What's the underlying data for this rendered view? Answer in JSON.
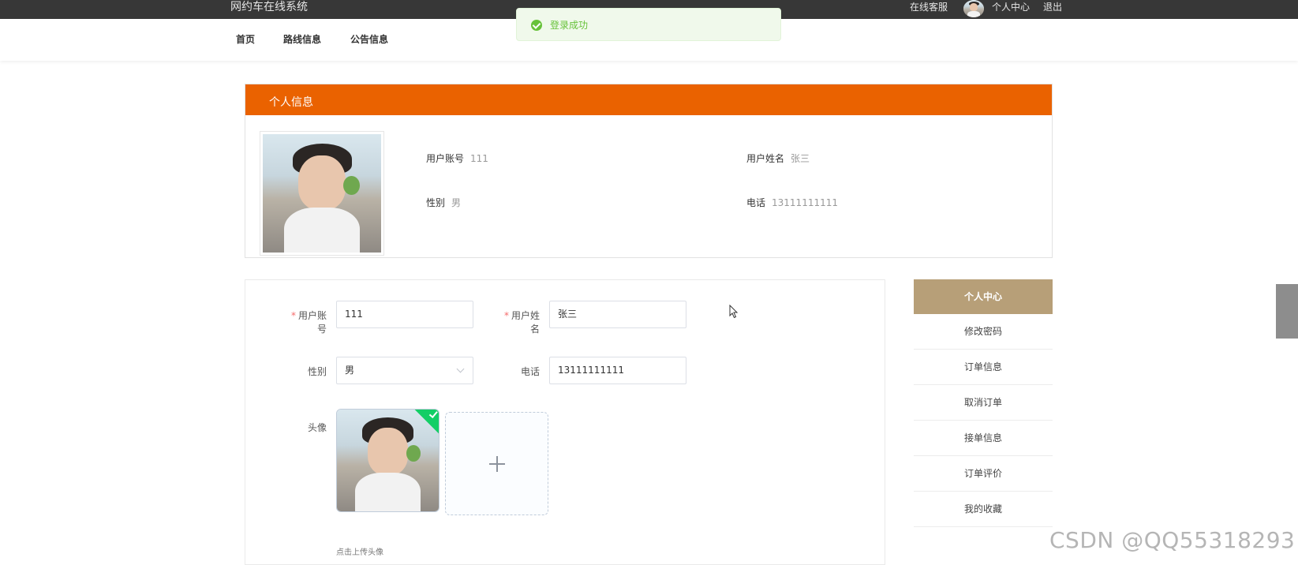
{
  "topbar": {
    "site_title": "网约车在线系统",
    "service": "在线客服",
    "user_center": "个人中心",
    "logout": "退出"
  },
  "nav": {
    "items": [
      {
        "label": "首页"
      },
      {
        "label": "路线信息"
      },
      {
        "label": "公告信息"
      }
    ]
  },
  "toast": {
    "message": "登录成功",
    "color": "#67c23a"
  },
  "info_card": {
    "title": "个人信息",
    "header_color": "#ea6200",
    "fields": {
      "account_label": "用户账号",
      "account_value": "111",
      "name_label": "用户姓名",
      "name_value": "张三",
      "gender_label": "性别",
      "gender_value": "男",
      "phone_label": "电话",
      "phone_value": "13111111111"
    }
  },
  "form": {
    "account_label": "用户账号",
    "account_value": "111",
    "name_label": "用户姓名",
    "name_value": "张三",
    "gender_label": "性别",
    "gender_value": "男",
    "phone_label": "电话",
    "phone_value": "13111111111",
    "avatar_label": "头像",
    "upload_tip": "点击上传头像"
  },
  "side_menu": {
    "header": "个人中心",
    "header_color": "#b79f78",
    "items": [
      {
        "label": "修改密码"
      },
      {
        "label": "订单信息"
      },
      {
        "label": "取消订单"
      },
      {
        "label": "接单信息"
      },
      {
        "label": "订单评价"
      },
      {
        "label": "我的收藏"
      }
    ]
  },
  "watermark": "CSDN @QQ55318293"
}
